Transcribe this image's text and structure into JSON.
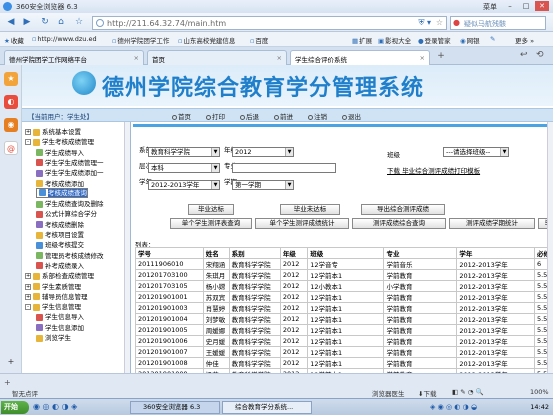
{
  "browser": {
    "title": "360安全浏览器 6.3",
    "menu_label": "菜单",
    "url": "http://211.64.32.74/main.htm",
    "search_placeholder": "疑似马航残骸"
  },
  "favorites": {
    "label": "收藏",
    "items": [
      "http://www.dzu.ed",
      "德州学院团学工作",
      "山东高校党建信息",
      "百度"
    ],
    "right_items": [
      "扩展",
      "影视大全",
      "登录管家",
      "网银",
      "更多"
    ]
  },
  "tabs": [
    {
      "label": "德州学院团学工作网络平台"
    },
    {
      "label": "首页"
    },
    {
      "label": "学生综合评价系统"
    }
  ],
  "page": {
    "title": "德州学院综合教育学分管理系统",
    "current_user": "【当前用户：学生处】",
    "toolbar": [
      "首页",
      "打印",
      "后退",
      "前进",
      "注销",
      "退出"
    ]
  },
  "tree": [
    {
      "label": "系统基本设置",
      "level": 0,
      "expand": "+"
    },
    {
      "label": "学生考核成绩管理",
      "level": 0,
      "expand": "-"
    },
    {
      "label": "学生成绩导入",
      "level": 1
    },
    {
      "label": "学生学生成绩管理一",
      "level": 1
    },
    {
      "label": "学生学生成绩添加一",
      "level": 1
    },
    {
      "label": "考核成绩添加",
      "level": 1
    },
    {
      "label": "考核成绩查询",
      "level": 1,
      "selected": true
    },
    {
      "label": "学生成绩查询及删除",
      "level": 1
    },
    {
      "label": "公式计算综合学分",
      "level": 1
    },
    {
      "label": "考核成绩删除",
      "level": 1
    },
    {
      "label": "考核项目设置",
      "level": 1
    },
    {
      "label": "班级考核提交",
      "level": 1
    },
    {
      "label": "管理员考核成绩修改",
      "level": 1
    },
    {
      "label": "补考成绩录入",
      "level": 1
    },
    {
      "label": "系部检查成绩管理",
      "level": 0,
      "expand": "+"
    },
    {
      "label": "学生素质管理",
      "level": 0,
      "expand": "+"
    },
    {
      "label": "辅导员信息管理",
      "level": 0,
      "expand": "+"
    },
    {
      "label": "学生信息管理",
      "level": 0,
      "expand": "-"
    },
    {
      "label": "学生信息导入",
      "level": 1
    },
    {
      "label": "学生信息添加",
      "level": 1
    },
    {
      "label": "浏览学生",
      "level": 1
    }
  ],
  "form": {
    "dept_label": "系部",
    "dept_value": "教育科学学院",
    "grade_label": "年级",
    "grade_value": "2012",
    "class_label": "班级",
    "class_value": "---请选择班级--",
    "level_label": "层次",
    "level_value": "本科",
    "major_label": "专业",
    "download_link": "下载  毕业综合测评成绩打印模板",
    "year_label": "学年",
    "year_value": "2012-2013学年",
    "term_label": "学期",
    "term_value": "第一学期",
    "buttons_row1": [
      "毕业达标",
      "毕业未达标",
      "导出综合测评成绩"
    ],
    "buttons_row2": [
      "单个学生测评表查询",
      "单个学生测评成绩统计",
      "测评成绩综合查询",
      "测评成绩学期统计",
      "毕"
    ]
  },
  "table": {
    "caption": "列表：",
    "columns": [
      "学号",
      "姓名",
      "系别",
      "年级",
      "班级",
      "专业",
      "学年",
      "必修"
    ],
    "rows": [
      [
        "20111906010",
        "宋翔涵",
        "教育科学学院",
        "2012",
        "12学音专",
        "学前音乐",
        "2012-2013学年",
        "6"
      ],
      [
        "201201703100",
        "朱琪月",
        "教育科学学院",
        "2012",
        "12学前本1",
        "学前教育",
        "2012-2013学年",
        "5.5"
      ],
      [
        "201201703105",
        "杨小嫦",
        "教育科学学院",
        "2012",
        "12小教本1",
        "小学教育",
        "2012-2013学年",
        "5.5"
      ],
      [
        "201201901001",
        "苏双宾",
        "教育科学学院",
        "2012",
        "12学前本1",
        "学前教育",
        "2012-2013学年",
        "5.5"
      ],
      [
        "201201901003",
        "肖慧婷",
        "教育科学学院",
        "2012",
        "12学前本1",
        "学前教育",
        "2012-2013学年",
        "5.5"
      ],
      [
        "201201901004",
        "刘梦敏",
        "教育科学学院",
        "2012",
        "12学前本1",
        "学前教育",
        "2012-2013学年",
        "5.5"
      ],
      [
        "201201901005",
        "周媛娜",
        "教育科学学院",
        "2012",
        "12学前本1",
        "学前教育",
        "2012-2013学年",
        "5.5"
      ],
      [
        "201201901006",
        "史月媛",
        "教育科学学院",
        "2012",
        "12学前本1",
        "学前教育",
        "2012-2013学年",
        "5.5"
      ],
      [
        "201201901007",
        "王媛媛",
        "教育科学学院",
        "2012",
        "12学前本1",
        "学前教育",
        "2012-2013学年",
        "5.5"
      ],
      [
        "201201901008",
        "仲佳",
        "教育科学学院",
        "2012",
        "12学前本1",
        "学前教育",
        "2012-2013学年",
        "5.5"
      ],
      [
        "201201901009",
        "梁莹",
        "教育科学学院",
        "2012",
        "12学前本1",
        "学前教育",
        "2012-2013学年",
        "5.5"
      ]
    ]
  },
  "status": {
    "left": "智无点评",
    "doctor": "浏览器医生",
    "download": "下载",
    "zoom": "100%"
  },
  "taskbar": {
    "start": "开始",
    "tasks": [
      "360安全浏览器 6.3",
      "综合教育学分系统..."
    ],
    "clock": "14:42"
  },
  "colors": {
    "accent": "#1f7fca",
    "selected": "#316ac5"
  }
}
